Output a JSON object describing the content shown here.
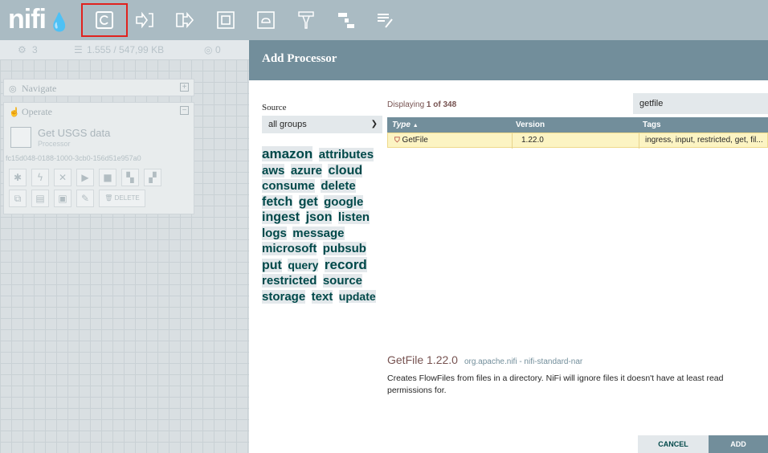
{
  "app": {
    "logo": "nifi"
  },
  "toolbar": {
    "icons": [
      "processor-icon",
      "input-port-icon",
      "output-port-icon",
      "process-group-icon",
      "remote-process-group-icon",
      "funnel-icon",
      "template-icon",
      "label-icon"
    ],
    "highlight_color": "#e0221e"
  },
  "status": {
    "thread_count": "3",
    "queued": "1.555 / 547,99 KB",
    "running": "0"
  },
  "navigate_panel": {
    "title": "Navigate"
  },
  "operate_panel": {
    "title": "Operate",
    "selection_name": "Get USGS data",
    "selection_type": "Processor",
    "selection_id": "fc15d048-0188-1000-3cb0-156d51e957a0",
    "delete_label": "DELETE"
  },
  "dialog": {
    "title": "Add Processor",
    "source_label": "Source",
    "source_value": "all groups",
    "tags": [
      {
        "text": "amazon",
        "size": 17
      },
      {
        "text": "attributes",
        "size": 15
      },
      {
        "text": "aws",
        "size": 15
      },
      {
        "text": "azure",
        "size": 15
      },
      {
        "text": "cloud",
        "size": 16
      },
      {
        "text": "consume",
        "size": 15
      },
      {
        "text": "delete",
        "size": 15
      },
      {
        "text": "fetch",
        "size": 16
      },
      {
        "text": "get",
        "size": 16
      },
      {
        "text": "google",
        "size": 15
      },
      {
        "text": "ingest",
        "size": 16
      },
      {
        "text": "json",
        "size": 16
      },
      {
        "text": "listen",
        "size": 15
      },
      {
        "text": "logs",
        "size": 15
      },
      {
        "text": "message",
        "size": 15
      },
      {
        "text": "microsoft",
        "size": 15
      },
      {
        "text": "pubsub",
        "size": 15
      },
      {
        "text": "put",
        "size": 16
      },
      {
        "text": "query",
        "size": 14
      },
      {
        "text": "record",
        "size": 17
      },
      {
        "text": "restricted",
        "size": 15
      },
      {
        "text": "source",
        "size": 15
      },
      {
        "text": "storage",
        "size": 15
      },
      {
        "text": "text",
        "size": 15
      },
      {
        "text": "update",
        "size": 14
      }
    ],
    "displaying_prefix": "Displaying",
    "displaying_count": "1 of 348",
    "filter_value": "getfile",
    "columns": {
      "type": "Type",
      "type_sort": "▲",
      "version": "Version",
      "tags": "Tags"
    },
    "rows": [
      {
        "type": "GetFile",
        "version": "1.22.0",
        "tags": "ingress, input, restricted, get, fil..."
      }
    ],
    "detail": {
      "name": "GetFile 1.22.0",
      "bundle": "org.apache.nifi - nifi-standard-nar",
      "description": "Creates FlowFiles from files in a directory. NiFi will ignore files it doesn't have at least read permissions for."
    },
    "cancel_label": "CANCEL",
    "add_label": "ADD"
  },
  "colors": {
    "header": "#728e9b",
    "selected_row": "#fcf4c3",
    "tag_text": "#004849"
  }
}
